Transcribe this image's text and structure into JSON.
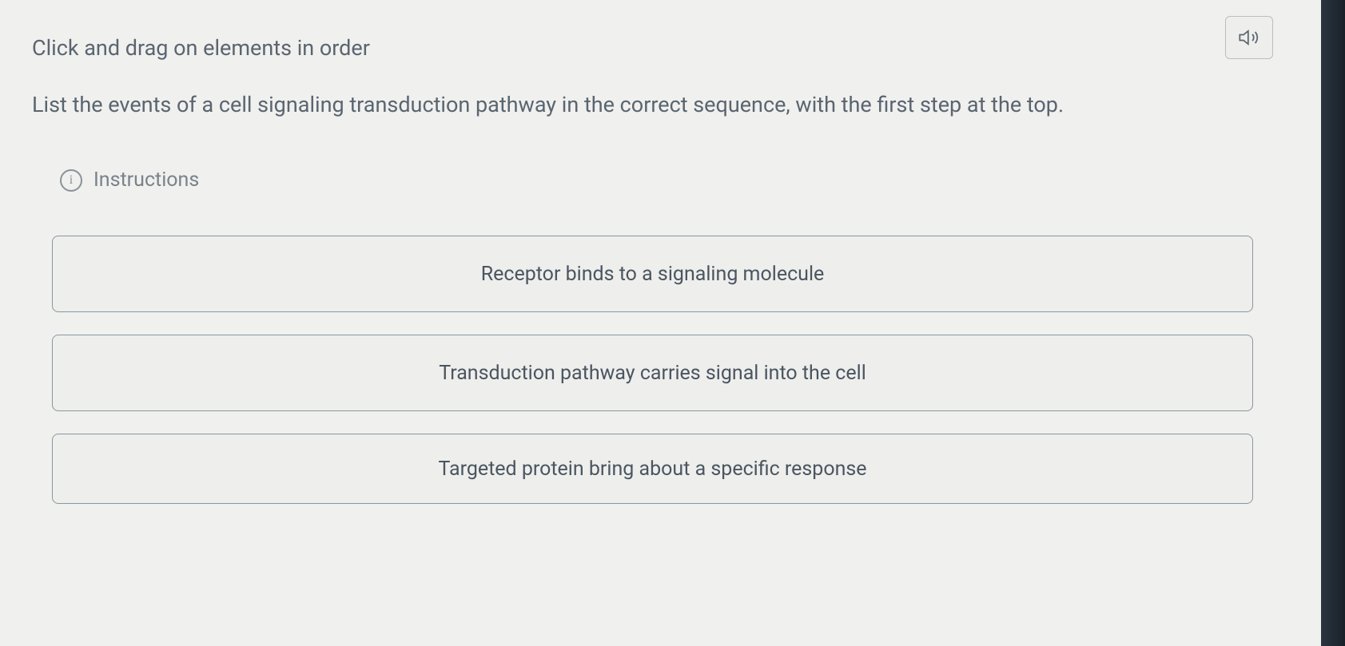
{
  "header": {
    "instruction": "Click and drag on elements in order",
    "question": "List the events of a cell signaling transduction pathway in the correct sequence, with the first step at the top."
  },
  "instructions": {
    "label": "Instructions"
  },
  "items": [
    {
      "text": "Receptor binds to a signaling molecule"
    },
    {
      "text": "Transduction pathway carries signal into the cell"
    },
    {
      "text": "Targeted protein bring about a specific response"
    }
  ]
}
